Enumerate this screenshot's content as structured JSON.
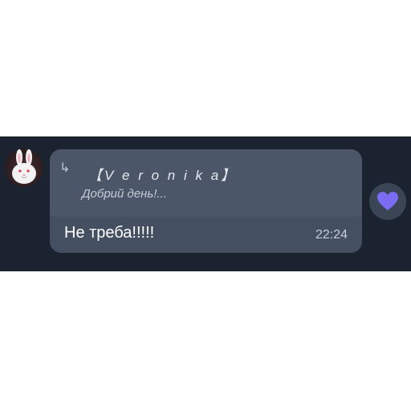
{
  "message": {
    "reply": {
      "arrow_icon": "reply-arrow-icon",
      "author": "【V e r o n i k a】",
      "text": "Добрий день!..."
    },
    "text": "Не треба!!!!!",
    "time": "22:24"
  },
  "avatar": {
    "icon": "white-rabbit-avatar"
  },
  "reaction": {
    "icon": "purple-heart-icon",
    "color": "#7b6cf3"
  },
  "colors": {
    "background": "#1b2330",
    "bubble": "#445061",
    "quote": "#4b5769"
  }
}
